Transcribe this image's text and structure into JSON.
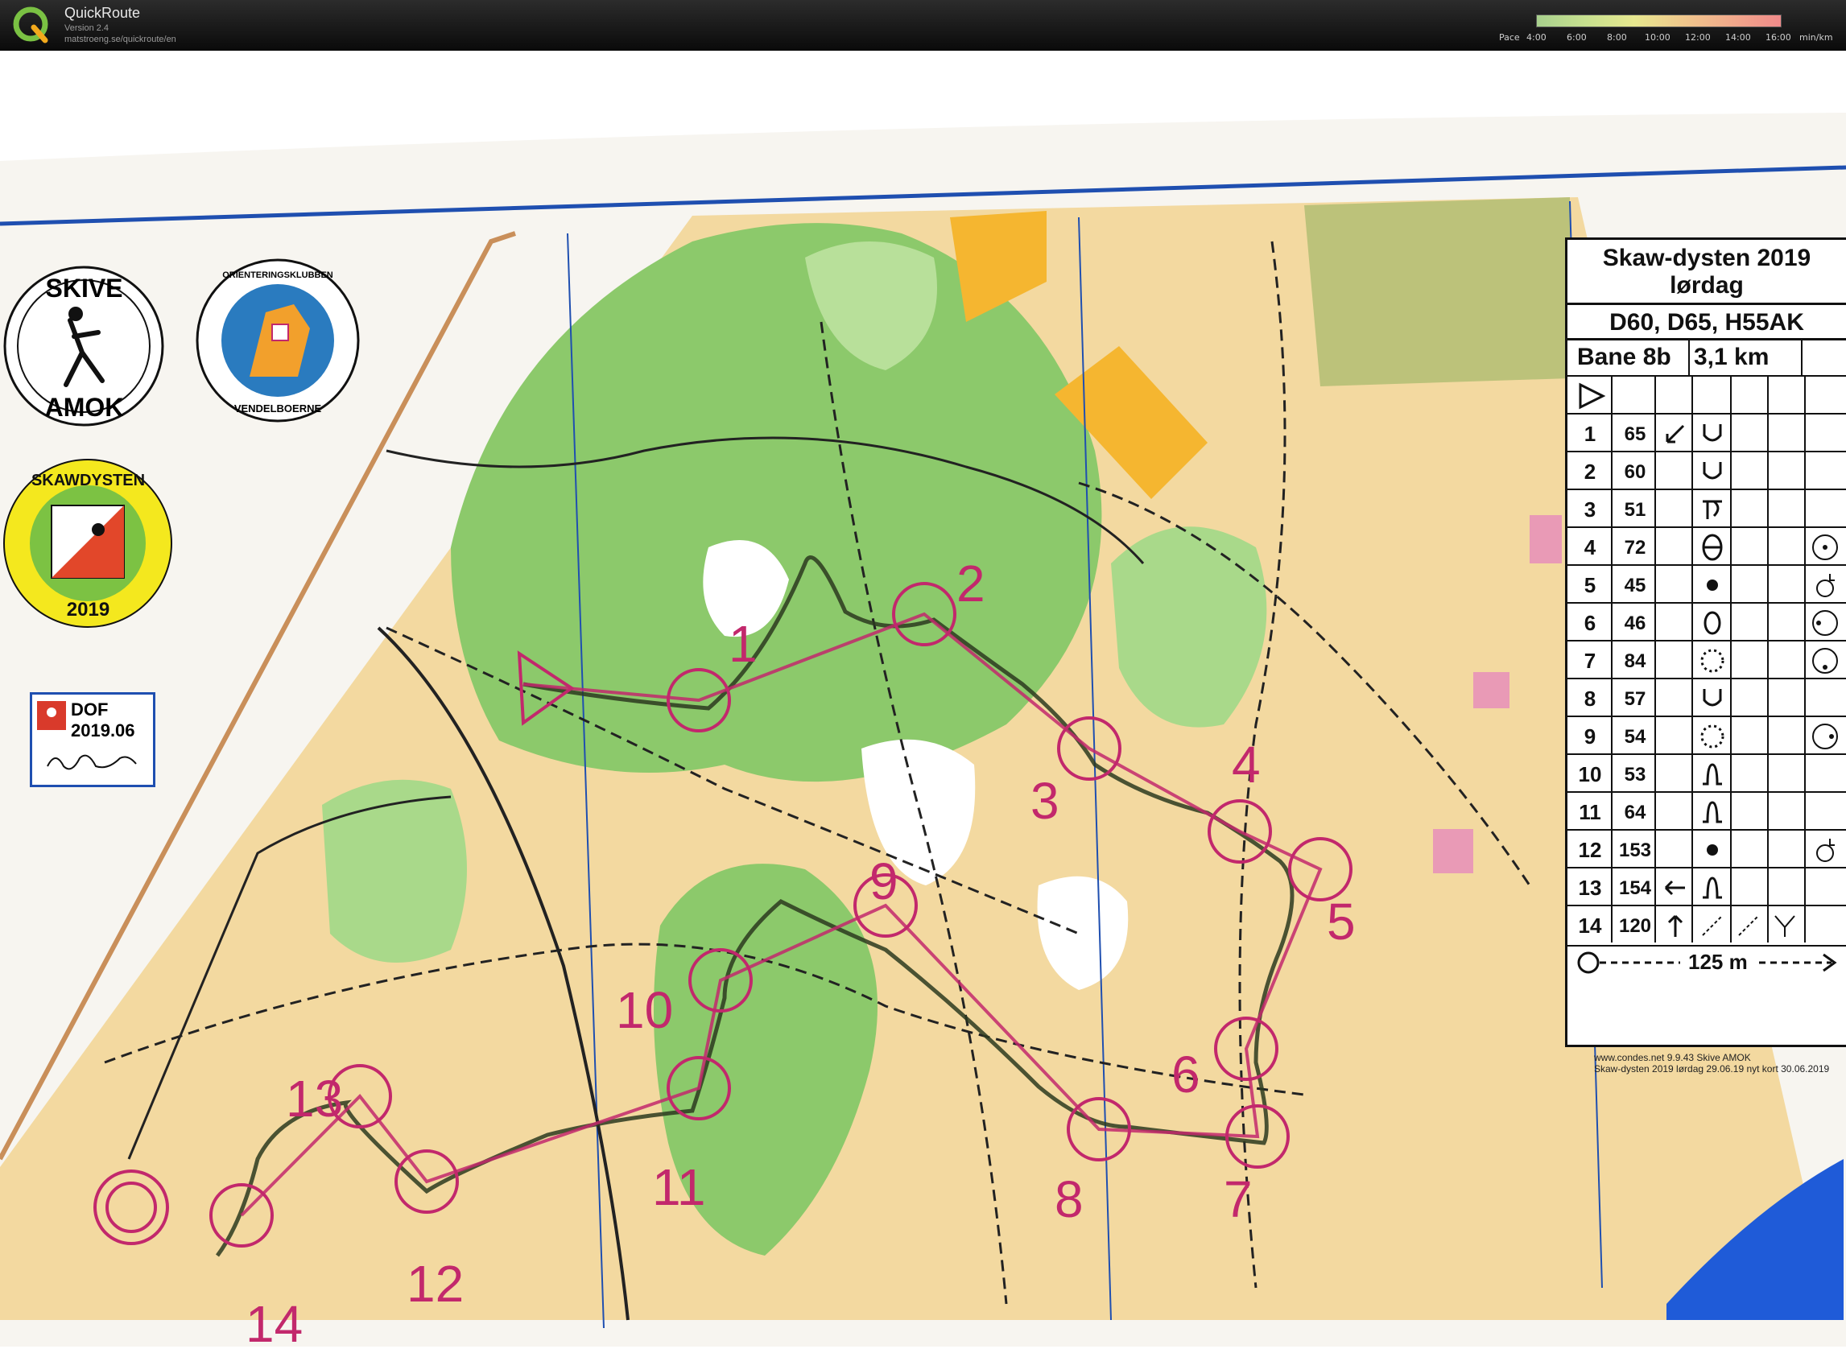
{
  "app": {
    "name": "QuickRoute",
    "version": "Version 2.4",
    "url": "matstroeng.se/quickroute/en"
  },
  "pace_legend": {
    "label": "Pace",
    "ticks": [
      "4:00",
      "6:00",
      "8:00",
      "10:00",
      "12:00",
      "14:00",
      "16:00"
    ],
    "unit": "min/km",
    "colors": [
      "#a8d08d",
      "#c7e08f",
      "#e6e78f",
      "#efc78c",
      "#f1a98b",
      "#f08a8a"
    ]
  },
  "logos": {
    "skive": {
      "top": "SKIVE",
      "bottom": "AMOK"
    },
    "vendelboerne": {
      "top": "ORIENTERINGSKLUBBEN",
      "bottom": "VENDELBOERNE"
    },
    "skawdysten": {
      "top": "SKAWDYSTEN",
      "year": "2019"
    },
    "dof": {
      "line1": "DOF",
      "line2": "2019.06"
    }
  },
  "course_card": {
    "title": "Skaw-dysten 2019",
    "subtitle": "lørdag",
    "classes": "D60, D65, H55AK",
    "course": "Bane 8b",
    "distance": "3,1 km",
    "controls": [
      {
        "num": "1",
        "code": "65"
      },
      {
        "num": "2",
        "code": "60"
      },
      {
        "num": "3",
        "code": "51"
      },
      {
        "num": "4",
        "code": "72"
      },
      {
        "num": "5",
        "code": "45"
      },
      {
        "num": "6",
        "code": "46"
      },
      {
        "num": "7",
        "code": "84"
      },
      {
        "num": "8",
        "code": "57"
      },
      {
        "num": "9",
        "code": "54"
      },
      {
        "num": "10",
        "code": "53"
      },
      {
        "num": "11",
        "code": "64"
      },
      {
        "num": "12",
        "code": "153"
      },
      {
        "num": "13",
        "code": "154"
      },
      {
        "num": "14",
        "code": "120"
      }
    ],
    "finish_distance": "125 m"
  },
  "map_controls": [
    "1",
    "2",
    "3",
    "4",
    "5",
    "6",
    "7",
    "8",
    "9",
    "10",
    "11",
    "12",
    "13",
    "14"
  ],
  "footer": {
    "line1": "www.condes.net 9.9.43 Skive AMOK",
    "line2": "Skaw-dysten 2019 lørdag 29.06.19 nyt kort 30.06.2019"
  },
  "colors": {
    "course": "#c2286c",
    "route": "#2b3a1f",
    "forest": "#8cc96b",
    "open": "#f3d9a0",
    "water": "#1f5bd8"
  }
}
